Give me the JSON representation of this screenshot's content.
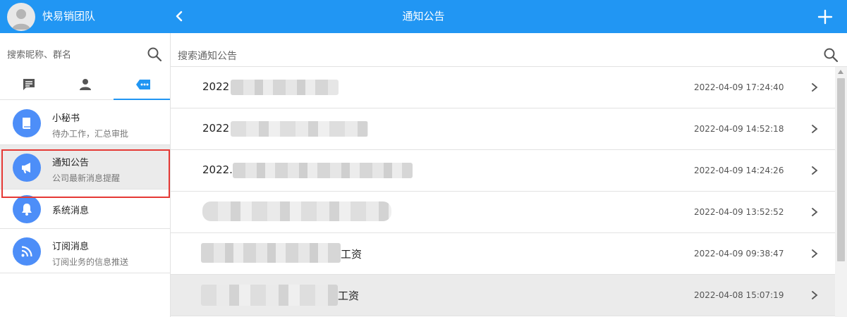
{
  "header": {
    "team_name": "快易销团队",
    "title": "通知公告",
    "accent_color": "#2196f3"
  },
  "sidebar": {
    "search_placeholder": "搜索昵称、群名",
    "tabs": [
      {
        "icon": "chat-icon",
        "active": false
      },
      {
        "icon": "contacts-icon",
        "active": false
      },
      {
        "icon": "more-apps-icon",
        "active": true
      }
    ],
    "items": [
      {
        "title": "小秘书",
        "subtitle": "待办工作，汇总审批",
        "icon": "book-icon"
      },
      {
        "title": "通知公告",
        "subtitle": "公司最新消息提醒",
        "icon": "megaphone-icon",
        "selected": true
      },
      {
        "title": "系统消息",
        "subtitle": "",
        "icon": "bell-icon"
      },
      {
        "title": "订阅消息",
        "subtitle": "订阅业务的信息推送",
        "icon": "rss-icon"
      }
    ]
  },
  "main": {
    "search_placeholder": "搜索通知公告",
    "notices": [
      {
        "title": "2022",
        "date": "2022-04-09 17:24:40"
      },
      {
        "title": "2022",
        "date": "2022-04-09 14:52:18"
      },
      {
        "title": "2022.",
        "date": "2022-04-09 14:24:26"
      },
      {
        "title": "",
        "date": "2022-04-09 13:52:52"
      },
      {
        "title": "工资",
        "date": "2022-04-09 09:38:47"
      },
      {
        "title": "工资",
        "date": "2022-04-08 15:07:19",
        "highlight": true
      }
    ]
  }
}
